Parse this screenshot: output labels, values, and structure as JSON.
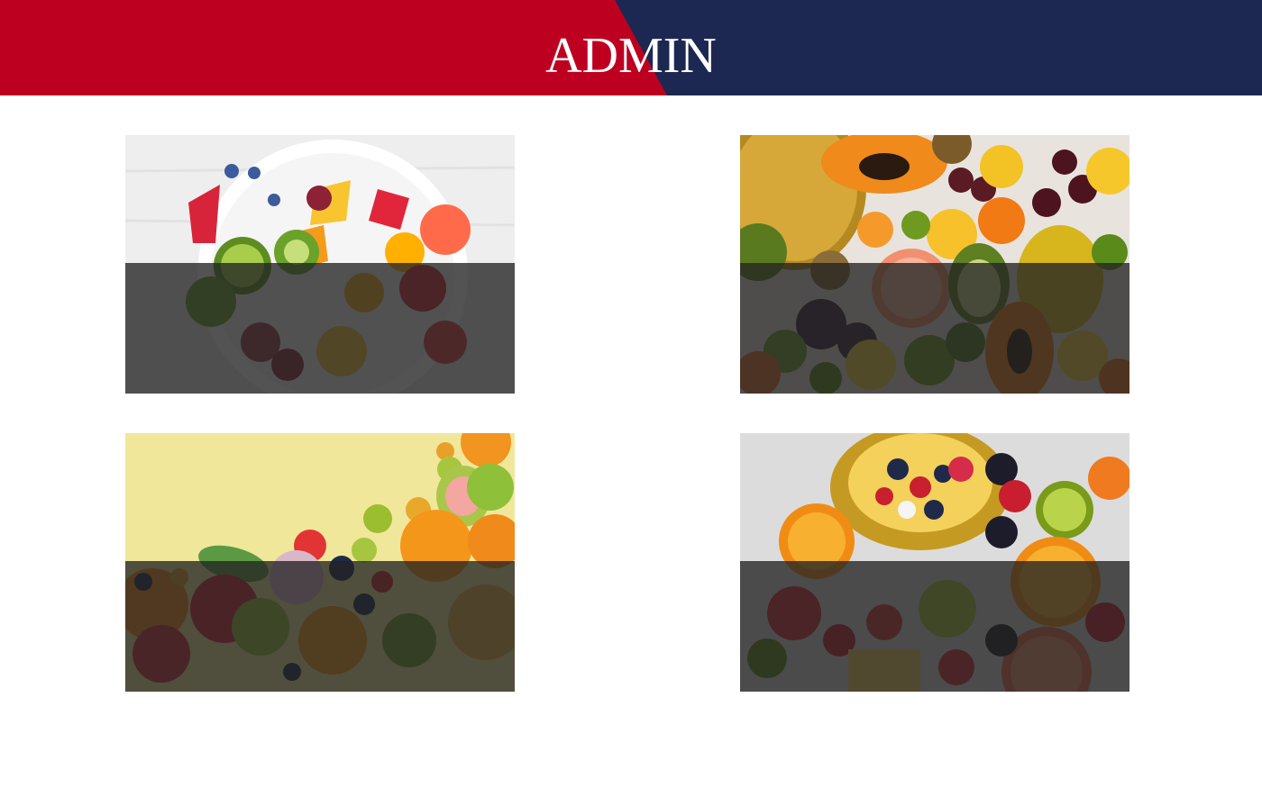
{
  "header": {
    "title": "ADMIN",
    "colors": {
      "left": "#be0020",
      "right": "#1c2851",
      "text": "#ffffff"
    }
  },
  "cards": [
    {
      "image": "fruit-salad-bowl-photo"
    },
    {
      "image": "tropical-fruits-assortment-photo"
    },
    {
      "image": "fruits-on-yellow-background-photo"
    },
    {
      "image": "pineapple-fruit-platter-photo"
    }
  ],
  "overlay_color": "#222222"
}
